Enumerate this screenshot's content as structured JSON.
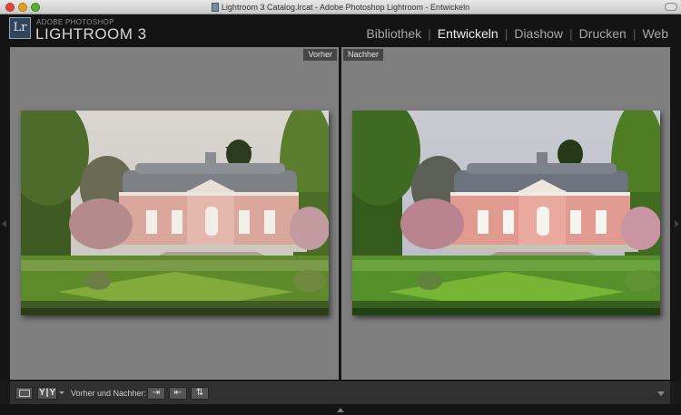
{
  "window": {
    "title": "Lightroom 3 Catalog.lrcat - Adobe Photoshop Lightroom - Entwickeln"
  },
  "header": {
    "logo_text": "Lr",
    "brand_top": "ADOBE PHOTOSHOP",
    "brand_main": "LIGHTROOM 3",
    "modules": [
      {
        "label": "Bibliothek",
        "active": false
      },
      {
        "label": "Entwickeln",
        "active": true
      },
      {
        "label": "Diashow",
        "active": false
      },
      {
        "label": "Drucken",
        "active": false
      },
      {
        "label": "Web",
        "active": false
      }
    ]
  },
  "compare": {
    "before_label": "Vorher",
    "after_label": "Nachher"
  },
  "toolbar": {
    "view_toggle_label": "Y|Y",
    "before_after_label": "Vorher und Nachher:"
  },
  "icons": {
    "loupe_view": "loupe-view-icon",
    "before_after_view": "before-after-view-icon",
    "copy_before_to_after": "copy-before-to-after-icon",
    "copy_after_to_before": "copy-after-to-before-icon",
    "swap_settings": "swap-settings-icon",
    "toolbar_menu": "chevron-down-icon"
  }
}
